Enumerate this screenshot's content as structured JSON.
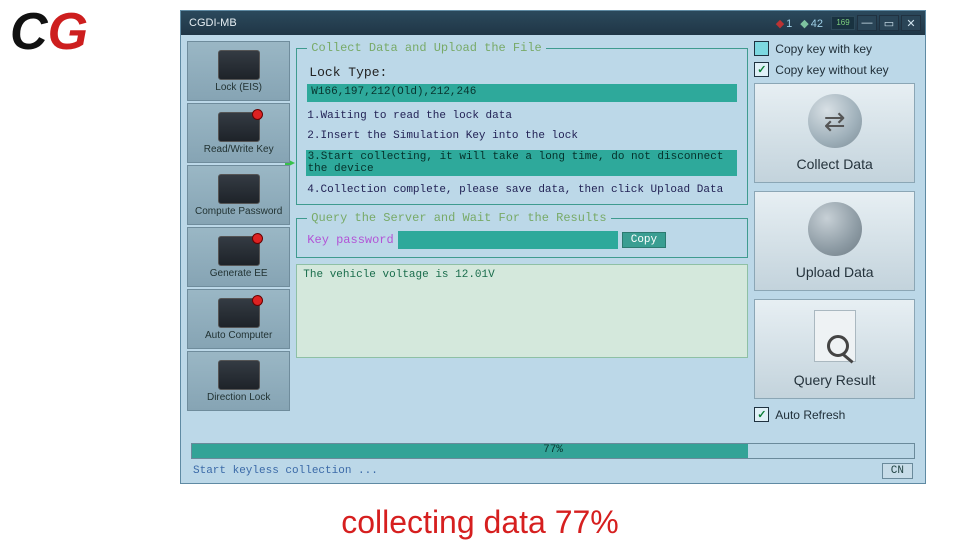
{
  "title": "CGDI-MB",
  "gems": {
    "red": "1",
    "green": "42",
    "batt": "169"
  },
  "sidebar": {
    "items": [
      {
        "label": "Lock (EIS)"
      },
      {
        "label": "Read/Write Key"
      },
      {
        "label": "Compute Password"
      },
      {
        "label": "Generate EE"
      },
      {
        "label": "Auto Computer"
      },
      {
        "label": "Direction Lock"
      }
    ]
  },
  "collect": {
    "legend": "Collect Data and Upload the File",
    "lock_type_label": "Lock Type:",
    "lock_type_value": "W166,197,212(Old),212,246",
    "steps": [
      "1.Waiting to read the lock data",
      "2.Insert the Simulation Key into the lock",
      "3.Start collecting, it will take a long time, do not disconnect the device",
      "4.Collection complete, please save data, then click Upload Data"
    ]
  },
  "query": {
    "legend": "Query the Server and Wait For the Results",
    "label": "Key password",
    "copy": "Copy"
  },
  "log": "The vehicle voltage is 12.01V",
  "right": {
    "opt1": "Copy key with key",
    "opt2": "Copy key without key",
    "btn1": "Collect Data",
    "btn2": "Upload  Data",
    "btn3": "Query Result",
    "auto_refresh": "Auto Refresh"
  },
  "progress": {
    "label": "77%",
    "percent": 77
  },
  "status": "Start keyless collection ...",
  "lang": "CN",
  "caption": "collecting data 77%"
}
